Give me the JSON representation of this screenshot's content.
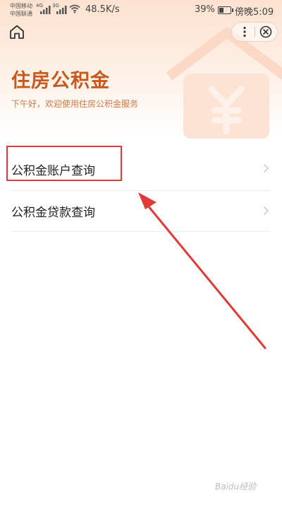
{
  "status_bar": {
    "carrier_1": "中国移动",
    "carrier_2": "中国联通",
    "net_badge_1": "4G",
    "net_badge_2": "3G",
    "speed": "48.5K/s",
    "battery_pct": "39%",
    "battery_level": 0.39,
    "time": "傍晚5:09"
  },
  "header": {
    "title": "住房公积金",
    "subtitle": "下午好，欢迎使用住房公积金服务"
  },
  "menu": {
    "items": [
      {
        "label": "公积金账户查询"
      },
      {
        "label": "公积金贷款查询"
      }
    ]
  },
  "watermark": "Baidu经验",
  "colors": {
    "accent": "#c75a1e",
    "subtitle": "#d07a4a",
    "annotation": "#e03a3a"
  },
  "icons": [
    "home-icon",
    "more-icon",
    "close-icon",
    "chevron-right-icon",
    "house-yuan-icon"
  ]
}
